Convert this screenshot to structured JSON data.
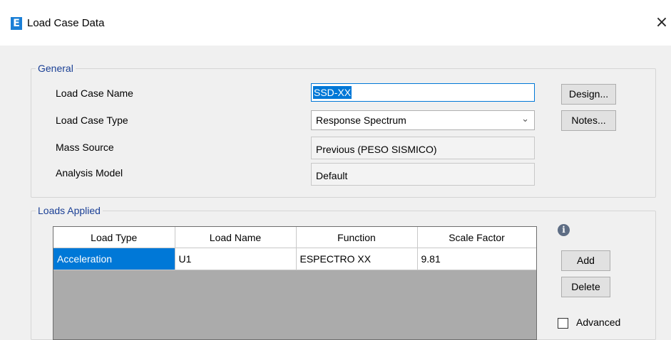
{
  "window": {
    "title": "Load Case Data",
    "logo_letter": "E",
    "close_glyph": "×"
  },
  "general": {
    "legend": "General",
    "load_case_name_label": "Load Case Name",
    "load_case_name_value": "SSD-XX",
    "load_case_type_label": "Load Case Type",
    "load_case_type_value": "Response Spectrum",
    "mass_source_label": "Mass Source",
    "mass_source_value": "Previous  (PESO SISMICO)",
    "analysis_model_label": "Analysis Model",
    "analysis_model_value": "Default",
    "design_button": "Design...",
    "notes_button": "Notes..."
  },
  "loads_applied": {
    "legend": "Loads Applied",
    "columns": [
      "Load Type",
      "Load Name",
      "Function",
      "Scale Factor"
    ],
    "rows": [
      [
        "Acceleration",
        "U1",
        "ESPECTRO XX",
        "9.81"
      ]
    ],
    "info_glyph": "i",
    "add_button": "Add",
    "delete_button": "Delete",
    "advanced_label": "Advanced",
    "advanced_checked": false
  },
  "icons": {
    "logo": "etabs-logo-icon",
    "close": "close-icon",
    "dropdown": "chevron-down-icon",
    "info": "info-icon"
  }
}
